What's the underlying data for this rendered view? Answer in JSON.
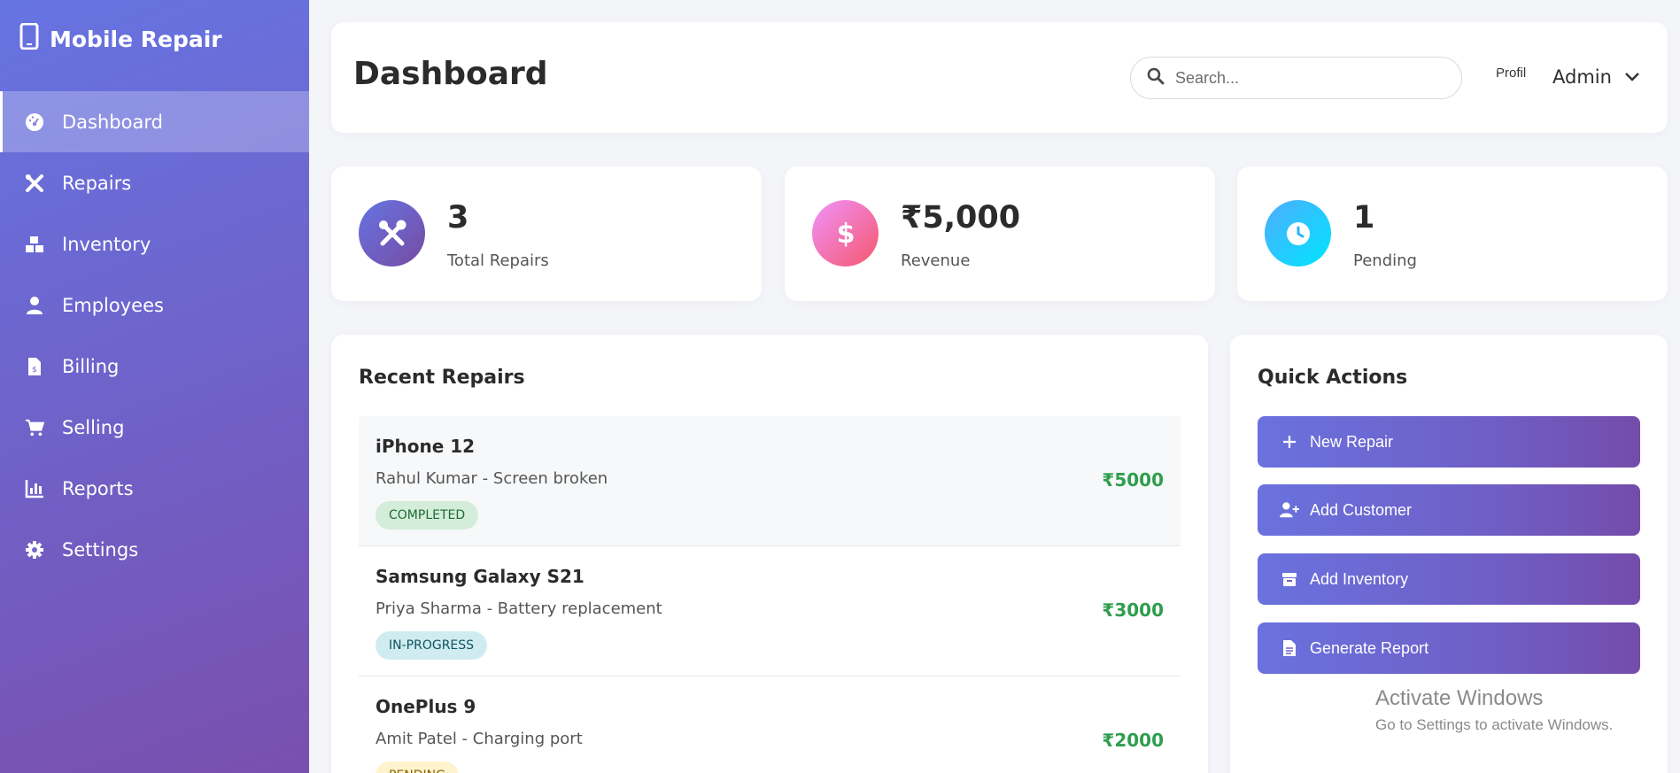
{
  "sidebar": {
    "brand": "Mobile Repair",
    "items": [
      {
        "label": "Dashboard",
        "icon": "dashboard-icon",
        "active": true
      },
      {
        "label": "Repairs",
        "icon": "tools-icon"
      },
      {
        "label": "Inventory",
        "icon": "boxes-icon"
      },
      {
        "label": "Employees",
        "icon": "user-icon"
      },
      {
        "label": "Billing",
        "icon": "invoice-icon"
      },
      {
        "label": "Selling",
        "icon": "cart-icon"
      },
      {
        "label": "Reports",
        "icon": "chart-icon"
      },
      {
        "label": "Settings",
        "icon": "gear-icon"
      }
    ]
  },
  "header": {
    "title": "Dashboard",
    "search_placeholder": "Search...",
    "avatar_alt": "Profil",
    "user_name": "Admin"
  },
  "stats": [
    {
      "value": "3",
      "label": "Total Repairs",
      "icon": "tools-icon",
      "color": "#6f62c9"
    },
    {
      "value": "₹5,000",
      "label": "Revenue",
      "icon": "dollar-icon",
      "color": "#f5576c"
    },
    {
      "value": "1",
      "label": "Pending",
      "icon": "clock-icon",
      "color": "#22c7f5"
    }
  ],
  "recent_repairs": {
    "title": "Recent Repairs",
    "items": [
      {
        "device": "iPhone 12",
        "desc": "Rahul Kumar - Screen broken",
        "status": "COMPLETED",
        "price": "₹5000"
      },
      {
        "device": "Samsung Galaxy S21",
        "desc": "Priya Sharma - Battery replacement",
        "status": "IN-PROGRESS",
        "price": "₹3000"
      },
      {
        "device": "OnePlus 9",
        "desc": "Amit Patel - Charging port",
        "status": "PENDING",
        "price": "₹2000"
      }
    ]
  },
  "quick_actions": {
    "title": "Quick Actions",
    "buttons": [
      {
        "label": "New Repair",
        "icon": "plus-icon"
      },
      {
        "label": "Add Customer",
        "icon": "user-plus-icon"
      },
      {
        "label": "Add Inventory",
        "icon": "box-icon"
      },
      {
        "label": "Generate Report",
        "icon": "file-icon"
      }
    ]
  },
  "watermark": {
    "line1": "Activate Windows",
    "line2": "Go to Settings to activate Windows."
  },
  "colors": {
    "accent": "#6674e2",
    "success": "#2e9e4e",
    "badge_completed_bg": "#d4edda",
    "badge_progress_bg": "#d1ecf1",
    "badge_pending_bg": "#fff3cd"
  }
}
